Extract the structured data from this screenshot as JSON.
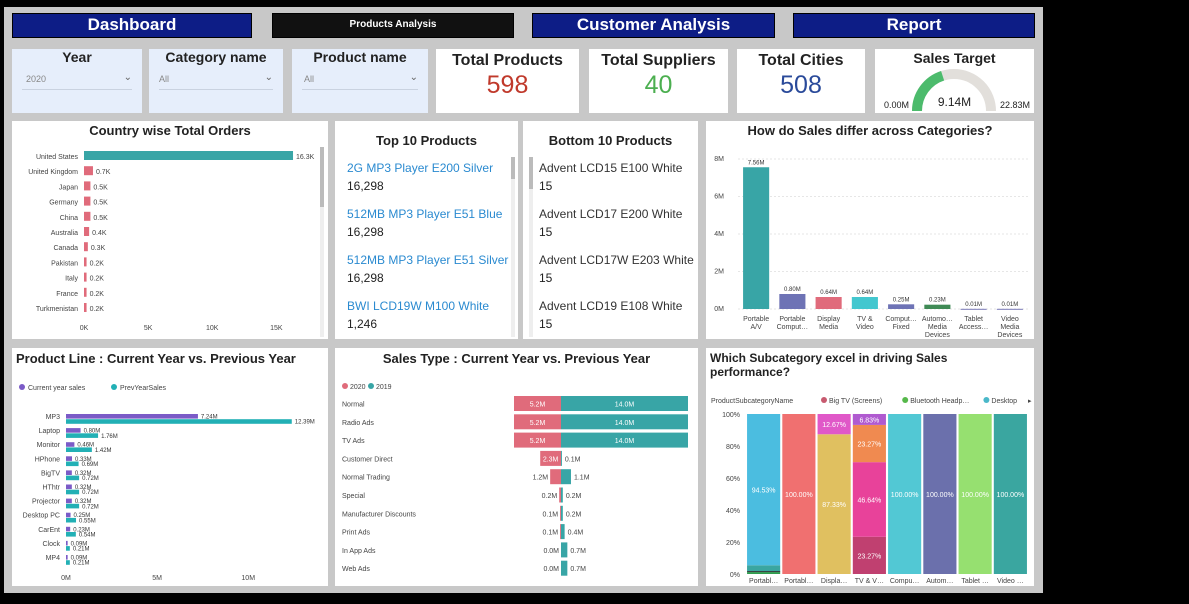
{
  "tabs": [
    {
      "label": "Dashboard",
      "active": false
    },
    {
      "label": "Products Analysis",
      "active": true
    },
    {
      "label": "Customer Analysis",
      "active": false
    },
    {
      "label": "Report",
      "active": false
    }
  ],
  "slicers": [
    {
      "title": "Year",
      "value": "2020"
    },
    {
      "title": "Category name",
      "value": "All"
    },
    {
      "title": "Product name",
      "value": "All"
    }
  ],
  "kpis": {
    "products": {
      "title": "Total Products",
      "value": "598",
      "color": "#c0392b"
    },
    "suppliers": {
      "title": "Total Suppliers",
      "value": "40",
      "color": "#4caf50"
    },
    "cities": {
      "title": "Total Cities",
      "value": "508",
      "color": "#2a4a9a"
    }
  },
  "gauge": {
    "title": "Sales Target",
    "value": "9.14M",
    "min": "0.00M",
    "max": "22.83M",
    "fraction": 0.4,
    "color": "#4cbb6c"
  },
  "top_products": {
    "title": "Top 10 Products",
    "items": [
      {
        "name": "2G MP3 Player E200 Silver",
        "value": "16,298"
      },
      {
        "name": "512MB MP3 Player E51 Blue",
        "value": "16,298"
      },
      {
        "name": "512MB MP3 Player E51 Silver",
        "value": "16,298"
      },
      {
        "name": "BWI LCD19W M100 White",
        "value": "1,246"
      }
    ]
  },
  "bottom_products": {
    "title": "Bottom 10 Products",
    "items": [
      {
        "name": "Advent LCD15 E100 White",
        "value": "15"
      },
      {
        "name": "Advent LCD17 E200 White",
        "value": "15"
      },
      {
        "name": "Advent LCD17W E203 White",
        "value": "15"
      },
      {
        "name": "Advent LCD19 E108 White",
        "value": "15"
      }
    ]
  },
  "chart_data": [
    {
      "id": "country",
      "type": "bar",
      "orientation": "horizontal",
      "title": "Country wise Total Orders",
      "categories": [
        "United States",
        "United Kingdom",
        "Japan",
        "Germany",
        "China",
        "Australia",
        "Canada",
        "Pakistan",
        "Italy",
        "France",
        "Turkmenistan"
      ],
      "values": [
        16300,
        700,
        500,
        500,
        500,
        400,
        300,
        200,
        200,
        200,
        200
      ],
      "labels": [
        "16.3K",
        "0.7K",
        "0.5K",
        "0.5K",
        "0.5K",
        "0.4K",
        "0.3K",
        "0.2K",
        "0.2K",
        "0.2K",
        "0.2K"
      ],
      "xticks": [
        "0K",
        "5K",
        "10K",
        "15K"
      ],
      "xtick_values": [
        0,
        5000,
        10000,
        15000
      ],
      "xlim": [
        0,
        17000
      ],
      "colors": {
        "first": "#38a5a6",
        "rest": "#e06b7b"
      }
    },
    {
      "id": "categories",
      "type": "bar",
      "title": "How do Sales differ across Categories?",
      "categories": [
        "Portable A/V",
        "Portable Comput…",
        "Display Media",
        "TV & Video",
        "Comput… Fixed",
        "Automo… Media Devices",
        "Tablet Access…",
        "Video Media Devices"
      ],
      "values": [
        7.56,
        0.8,
        0.64,
        0.64,
        0.25,
        0.23,
        0.01,
        0.01
      ],
      "labels": [
        "7.56M",
        "0.80M",
        "0.64M",
        "0.64M",
        "0.25M",
        "0.23M",
        "0.01M",
        "0.01M"
      ],
      "colors": [
        "#38a5a6",
        "#6e73b5",
        "#e06b7b",
        "#43c7cf",
        "#6e73b5",
        "#3f8a55",
        "#7b7bb8",
        "#7b7bb8"
      ],
      "yticks": [
        "0M",
        "2M",
        "4M",
        "6M",
        "8M"
      ],
      "ytick_values": [
        0,
        2,
        4,
        6,
        8
      ],
      "ylim": [
        0,
        8
      ]
    },
    {
      "id": "product_line",
      "type": "bar",
      "orientation": "horizontal",
      "title": "Product Line : Current Year vs. Previous Year",
      "legend": [
        {
          "name": "Current year sales",
          "color": "#7b5bc7"
        },
        {
          "name": "PrevYearSales",
          "color": "#22b0b5"
        }
      ],
      "categories": [
        "MP3",
        "Laptop",
        "Monitor",
        "HPhone",
        "BigTV",
        "HThtr",
        "Projector",
        "Desktop PC",
        "CarEnt",
        "Clock",
        "MP4"
      ],
      "series": [
        {
          "name": "Current year sales",
          "values": [
            7.24,
            0.8,
            0.46,
            0.33,
            0.32,
            0.32,
            0.32,
            0.25,
            0.23,
            0.09,
            0.09
          ],
          "labels": [
            "7.24M",
            "0.80M",
            "0.46M",
            "0.33M",
            "0.32M",
            "0.32M",
            "0.32M",
            "0.25M",
            "0.23M",
            "0.09M",
            "0.09M"
          ]
        },
        {
          "name": "PrevYearSales",
          "values": [
            12.39,
            1.76,
            1.42,
            0.69,
            0.72,
            0.72,
            0.72,
            0.55,
            0.54,
            0.21,
            0.21
          ],
          "labels": [
            "12.39M",
            "1.76M",
            "1.42M",
            "0.69M",
            "0.72M",
            "0.72M",
            "0.72M",
            "0.55M",
            "0.54M",
            "0.21M",
            "0.21M"
          ]
        }
      ],
      "xticks": [
        "0M",
        "5M",
        "10M"
      ],
      "xtick_values": [
        0,
        5,
        10
      ],
      "xlim": [
        0,
        13.5
      ]
    },
    {
      "id": "sales_type",
      "type": "bar",
      "orientation": "diverging",
      "title": "Sales Type : Current Year vs. Previous Year",
      "legend": [
        {
          "name": "2020",
          "color": "#e06b7b"
        },
        {
          "name": "2019",
          "color": "#38a5a6"
        }
      ],
      "categories": [
        "Normal",
        "Radio Ads",
        "TV Ads",
        "Customer Direct",
        "Normal Trading",
        "Special",
        "Manufacturer Discounts",
        "Print Ads",
        "In App Ads",
        "Web Ads"
      ],
      "series": [
        {
          "name": "2020",
          "values": [
            5.2,
            5.2,
            5.2,
            2.3,
            1.2,
            0.2,
            0.1,
            0.1,
            0.0,
            0.0
          ],
          "labels": [
            "5.2M",
            "5.2M",
            "5.2M",
            "2.3M",
            "1.2M",
            "0.2M",
            "0.1M",
            "0.1M",
            "0.0M",
            "0.0M"
          ]
        },
        {
          "name": "2019",
          "values": [
            14.0,
            14.0,
            14.0,
            0.1,
            1.1,
            0.2,
            0.2,
            0.4,
            0.7,
            0.7
          ],
          "labels": [
            "14.0M",
            "14.0M",
            "14.0M",
            "0.1M",
            "1.1M",
            "0.2M",
            "0.2M",
            "0.4M",
            "0.7M",
            "0.7M"
          ]
        }
      ],
      "xlim": [
        0,
        14.0
      ]
    },
    {
      "id": "subcategory",
      "type": "bar",
      "stacked": "100%",
      "title": "Which Subcategory excel in driving Sales performance?",
      "legend_title": "ProductSubcategoryName",
      "legend": [
        {
          "name": "Big TV (Screens)",
          "color": "#c75a6f"
        },
        {
          "name": "Bluetooth Headp…",
          "color": "#56b84a"
        },
        {
          "name": "Desktop",
          "color": "#4ab8c9"
        }
      ],
      "categories": [
        "Portabl…",
        "Portabl…",
        "Displa…",
        "TV & V…",
        "Compu…",
        "Autom…",
        "Tablet …",
        "Video …"
      ],
      "yticks": [
        "0%",
        "20%",
        "40%",
        "60%",
        "80%",
        "100%"
      ],
      "ytick_values": [
        0,
        20,
        40,
        60,
        80,
        100
      ],
      "ylim": [
        0,
        100
      ],
      "stacks": [
        [
          {
            "v": 1.2,
            "c": "#2f9e4f",
            "l": ""
          },
          {
            "v": 0.6,
            "c": "#222222",
            "l": ""
          },
          {
            "v": 3.67,
            "c": "#3aa6a0",
            "l": ""
          },
          {
            "v": 94.53,
            "c": "#4bbde0",
            "l": "94.53%"
          }
        ],
        [
          {
            "v": 100,
            "c": "#f07070",
            "l": "100.00%"
          }
        ],
        [
          {
            "v": 87.33,
            "c": "#e0c060",
            "l": "87.33%"
          },
          {
            "v": 12.67,
            "c": "#e058c8",
            "l": "12.67%"
          }
        ],
        [
          {
            "v": 23.27,
            "c": "#c04070",
            "l": "23.27%"
          },
          {
            "v": 46.64,
            "c": "#e8429a",
            "l": "46.64%"
          },
          {
            "v": 23.27,
            "c": "#f08a50",
            "l": "23.27%"
          },
          {
            "v": 6.83,
            "c": "#b05ad0",
            "l": "6.83%"
          }
        ],
        [
          {
            "v": 100,
            "c": "#52c8d4",
            "l": "100.00%"
          }
        ],
        [
          {
            "v": 100,
            "c": "#6b70ac",
            "l": "100.00%"
          }
        ],
        [
          {
            "v": 100,
            "c": "#96e070",
            "l": "100.00%"
          }
        ],
        [
          {
            "v": 100,
            "c": "#3aa6a0",
            "l": "100.00%"
          }
        ]
      ]
    }
  ]
}
